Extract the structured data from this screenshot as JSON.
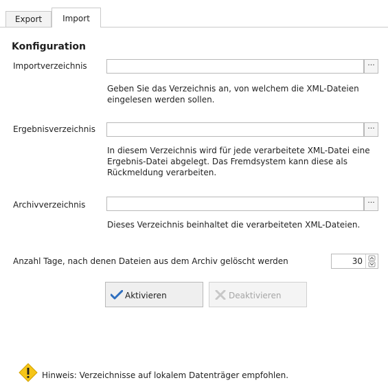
{
  "tabs": {
    "export": "Export",
    "import": "Import",
    "active": "Import"
  },
  "section_title": "Konfiguration",
  "import_dir": {
    "label": "Importverzeichnis",
    "value": "",
    "browse": "···",
    "help_lines": [
      "Geben Sie das Verzeichnis an, von welchem die XML-Dateien",
      "eingelesen werden sollen."
    ]
  },
  "result_dir": {
    "label": "Ergebnisverzeichnis",
    "value": "",
    "browse": "···",
    "help_lines": [
      "In diesem Verzeichnis wird für jede verarbeitete XML-Datei eine",
      "Ergebnis-Datei abgelegt. Das Fremdsystem kann diese als",
      "Rückmeldung verarbeiten."
    ]
  },
  "archive_dir": {
    "label": "Archivverzeichnis",
    "value": "",
    "browse": "···",
    "help_lines": [
      "Dieses Verzeichnis beinhaltet die verarbeiteten XML-Dateien."
    ]
  },
  "days": {
    "label": "Anzahl Tage, nach denen Dateien aus dem Archiv gelöscht werden",
    "value": "30"
  },
  "buttons": {
    "activate": "Aktivieren",
    "deactivate": "Deaktivieren"
  },
  "hint": {
    "text": "Hinweis: Verzeichnisse auf lokalem Datenträger empfohlen.",
    "icon": "warning-icon"
  },
  "colors": {
    "accent_check": "#2f6fbf",
    "warning": "#f5c518",
    "disabled": "#a6a6a6"
  }
}
